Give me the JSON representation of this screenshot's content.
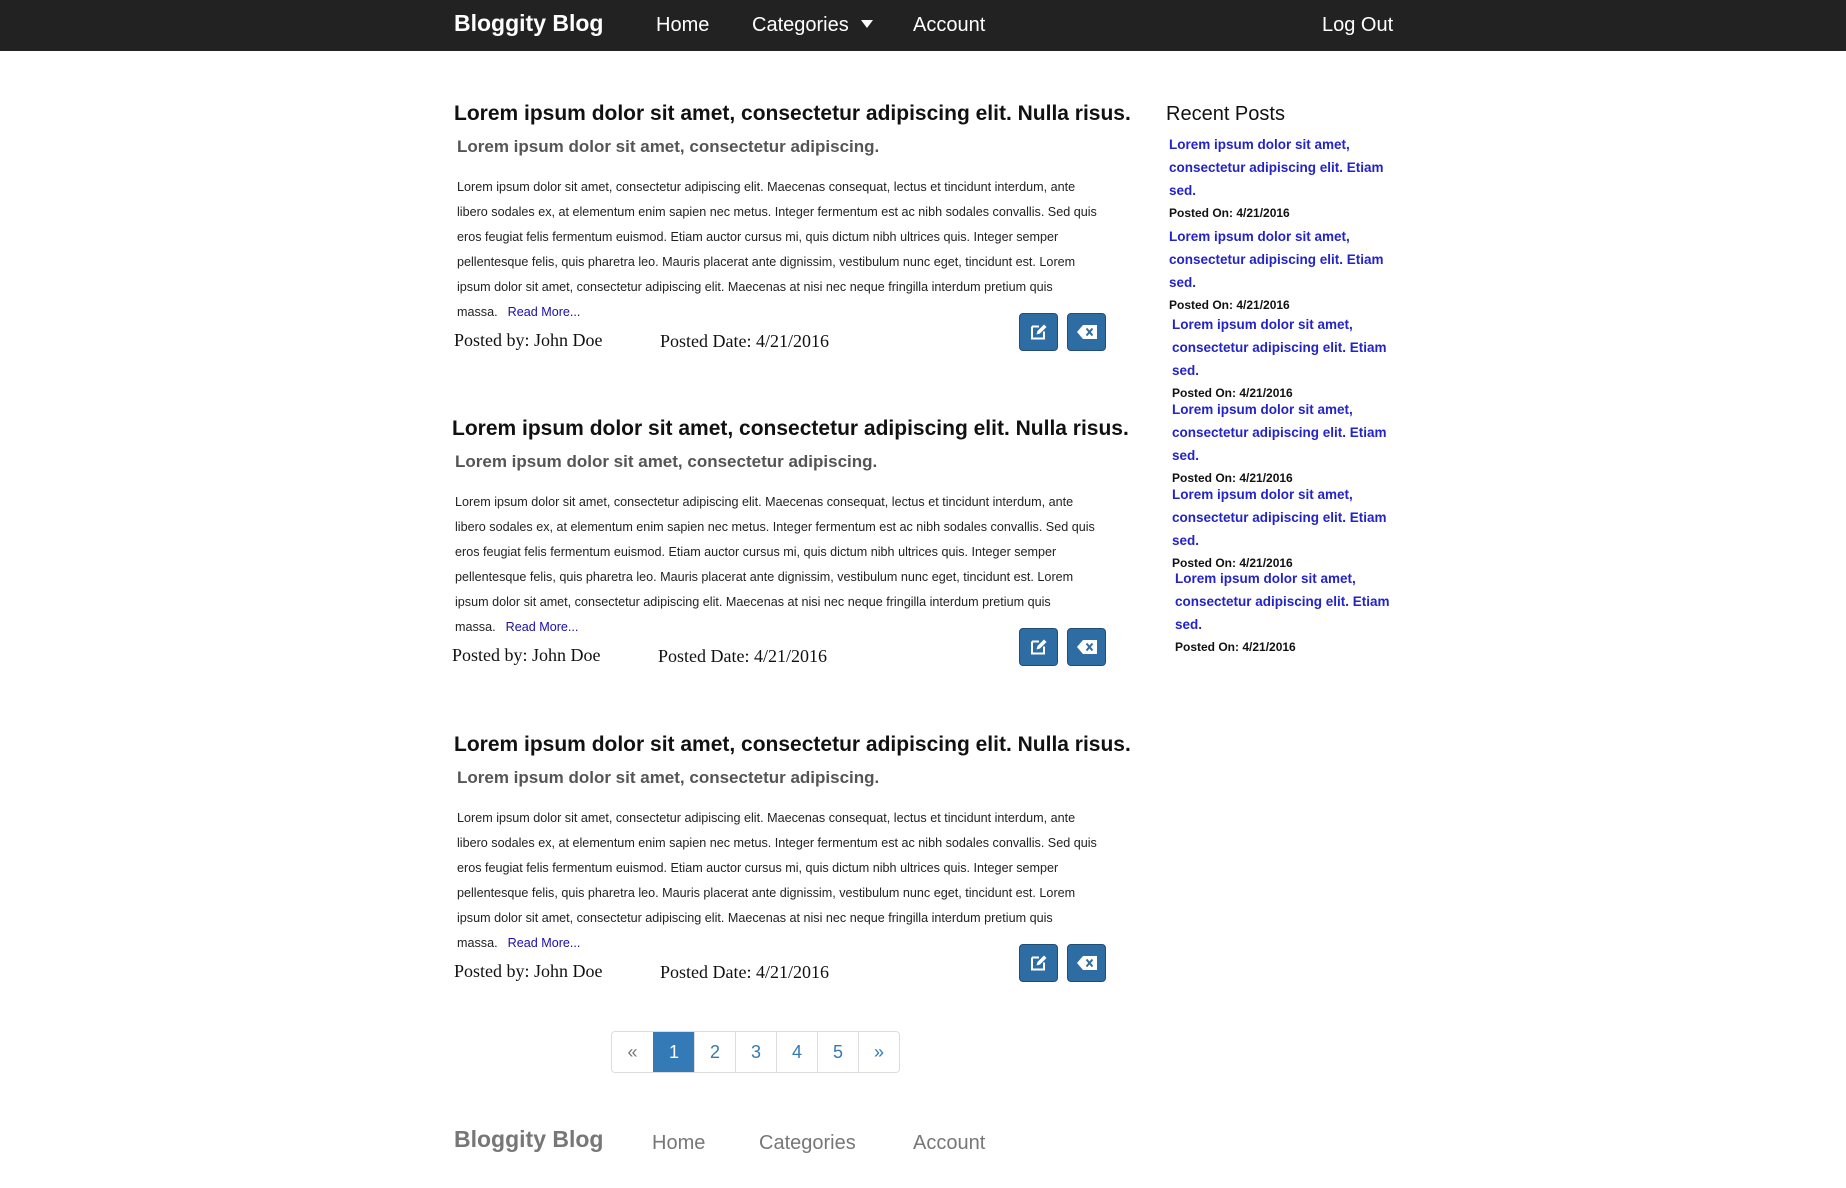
{
  "navbar": {
    "brand": "Bloggity Blog",
    "home": "Home",
    "categories": "Categories",
    "account": "Account",
    "logout": "Log Out"
  },
  "posts": [
    {
      "title": "Lorem ipsum dolor sit amet, consectetur adipiscing elit. Nulla risus.",
      "subtitle": "Lorem ipsum dolor sit amet, consectetur adipiscing.",
      "body": "Lorem ipsum dolor sit amet, consectetur adipiscing elit. Maecenas consequat, lectus et tincidunt interdum, ante libero sodales ex, at elementum enim sapien nec metus. Integer fermentum est ac nibh sodales convallis. Sed quis eros feugiat felis fermentum euismod. Etiam auctor cursus mi, quis dictum nibh ultrices quis. Integer semper pellentesque felis, quis pharetra leo. Mauris placerat ante dignissim, vestibulum nunc eget, tincidunt est. Lorem ipsum dolor sit amet, consectetur adipiscing elit. Maecenas at nisi nec neque fringilla interdum pretium quis massa.",
      "read_more": "Read More...",
      "author": "Posted by: John Doe",
      "date": "Posted Date: 4/21/2016"
    },
    {
      "title": "Lorem ipsum dolor sit amet, consectetur adipiscing elit. Nulla risus.",
      "subtitle": "Lorem ipsum dolor sit amet, consectetur adipiscing.",
      "body": "Lorem ipsum dolor sit amet, consectetur adipiscing elit. Maecenas consequat, lectus et tincidunt interdum, ante libero sodales ex, at elementum enim sapien nec metus. Integer fermentum est ac nibh sodales convallis. Sed quis eros feugiat felis fermentum euismod. Etiam auctor cursus mi, quis dictum nibh ultrices quis. Integer semper pellentesque felis, quis pharetra leo. Mauris placerat ante dignissim, vestibulum nunc eget, tincidunt est. Lorem ipsum dolor sit amet, consectetur adipiscing elit. Maecenas at nisi nec neque fringilla interdum pretium quis massa.",
      "read_more": "Read More...",
      "author": "Posted by: John Doe",
      "date": "Posted Date: 4/21/2016"
    },
    {
      "title": "Lorem ipsum dolor sit amet, consectetur adipiscing elit. Nulla risus.",
      "subtitle": "Lorem ipsum dolor sit amet, consectetur adipiscing.",
      "body": "Lorem ipsum dolor sit amet, consectetur adipiscing elit. Maecenas consequat, lectus et tincidunt interdum, ante libero sodales ex, at elementum enim sapien nec metus. Integer fermentum est ac nibh sodales convallis. Sed quis eros feugiat felis fermentum euismod. Etiam auctor cursus mi, quis dictum nibh ultrices quis. Integer semper pellentesque felis, quis pharetra leo. Mauris placerat ante dignissim, vestibulum nunc eget, tincidunt est. Lorem ipsum dolor sit amet, consectetur adipiscing elit. Maecenas at nisi nec neque fringilla interdum pretium quis massa.",
      "read_more": "Read More...",
      "author": "Posted by: John Doe",
      "date": "Posted Date: 4/21/2016"
    }
  ],
  "sidebar": {
    "title": "Recent Posts",
    "items": [
      {
        "link": "Lorem ipsum dolor sit amet, consectetur adipiscing elit. Etiam sed.",
        "date": "Posted On: 4/21/2016"
      },
      {
        "link": "Lorem ipsum dolor sit amet, consectetur adipiscing elit. Etiam sed.",
        "date": "Posted On: 4/21/2016"
      },
      {
        "link": "Lorem ipsum dolor sit amet, consectetur adipiscing elit. Etiam sed.",
        "date": "Posted On: 4/21/2016"
      },
      {
        "link": "Lorem ipsum dolor sit amet, consectetur adipiscing elit. Etiam sed.",
        "date": "Posted On: 4/21/2016"
      },
      {
        "link": "Lorem ipsum dolor sit amet, consectetur adipiscing elit. Etiam sed.",
        "date": "Posted On: 4/21/2016"
      },
      {
        "link": "Lorem ipsum dolor sit amet, consectetur adipiscing elit. Etiam sed.",
        "date": "Posted On: 4/21/2016"
      }
    ]
  },
  "pagination": {
    "prev": "«",
    "pages": [
      "1",
      "2",
      "3",
      "4",
      "5"
    ],
    "next": "»",
    "current_page": 1
  },
  "footer": {
    "brand": "Bloggity Blog",
    "home": "Home",
    "categories": "Categories",
    "account": "Account"
  },
  "icons": {
    "edit": "edit-icon",
    "delete": "backspace-icon",
    "dropdown": "caret-down-icon"
  },
  "colors": {
    "navbar_bg": "#222222",
    "button_primary": "#2e6da4",
    "link": "#2323c8",
    "pagination_active": "#337ab7"
  }
}
